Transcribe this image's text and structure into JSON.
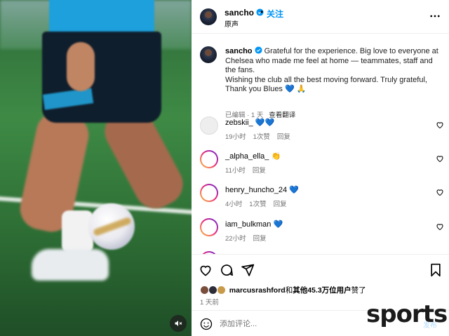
{
  "post": {
    "author": "sancho",
    "follow_label": "关注",
    "separator": "•",
    "audio_label": "原声",
    "caption_line1": "Grateful for the experience. Big love to everyone at Chelsea who made me feel at home — teammates, staff and the fans.",
    "caption_line2": "Wishing the club all the best moving forward. Truly grateful, Thank you Blues",
    "caption_emojis": "💙 🙏",
    "edited_meta": "已编辑 · 1 天",
    "translate_label": "查看翻译"
  },
  "comments": [
    {
      "username": "zebskii_",
      "emoji": "💙💙",
      "age": "19小时",
      "likes": "1次赞",
      "reply": "回复"
    },
    {
      "username": "_alpha_ella_",
      "emoji": "👏",
      "age": "11小时",
      "likes": "",
      "reply": "回复"
    },
    {
      "username": "henry_huncho_24",
      "emoji": "💙",
      "age": "4小时",
      "likes": "1次赞",
      "reply": "回复"
    },
    {
      "username": "iam_bulkman",
      "emoji": "💙",
      "age": "22小时",
      "likes": "",
      "reply": "回复"
    }
  ],
  "likes": {
    "user": "marcusrashford",
    "conj": "和",
    "others": "其他45.3万位用户",
    "suffix": "赞了"
  },
  "posted_ago": "1 天前",
  "compose": {
    "placeholder": "添加评论...",
    "post_label": "发布"
  },
  "watermark": "sports",
  "colors": {
    "accent": "#0095f6",
    "verified": "#0095f6",
    "heart_blue": "#1877f2"
  },
  "icons": {
    "mute": "speaker-muted-icon",
    "more": "more-horizontal-icon",
    "like": "heart-icon",
    "comment": "comment-bubble-icon",
    "share": "paper-plane-icon",
    "save": "bookmark-icon",
    "emoji": "smiley-icon"
  }
}
